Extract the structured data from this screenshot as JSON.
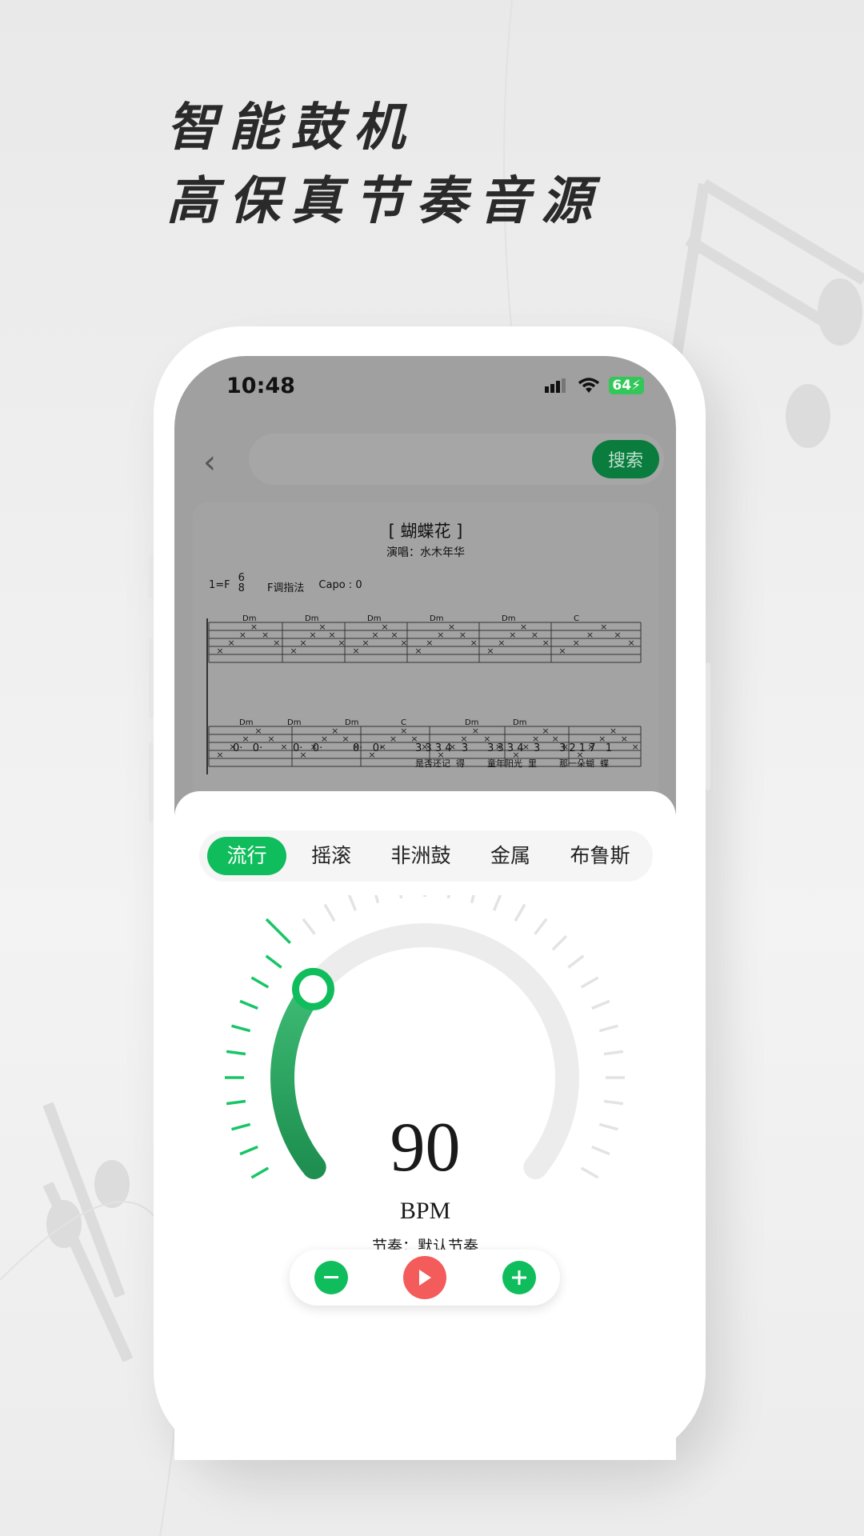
{
  "headline": {
    "line1": "智能鼓机",
    "line2": "高保真节奏音源"
  },
  "status_bar": {
    "time": "10:48",
    "battery": "64"
  },
  "search": {
    "value": "",
    "button": "搜索"
  },
  "score": {
    "title": "[ 蝴蝶花 ]",
    "singer": "演唱：水木年华",
    "key": "1=F",
    "time_sig_top": "6",
    "time_sig_bottom": "8",
    "fingering": "F调指法",
    "capo": "Capo : 0",
    "row1_chords": [
      "Dm",
      "Dm",
      "Dm",
      "Dm",
      "Dm",
      "C"
    ],
    "row1_notation": [
      "0·   0·",
      "0·   0·",
      "0·   0·",
      "3 3 3 4   3",
      "3 3 3 4   3",
      "3 2 1 7   1"
    ],
    "row1_lyrics": [
      "是否还记  得",
      "童年阳光  里",
      "那一朵蝴  蝶"
    ],
    "row2_chords": [
      "Dm",
      "Dm",
      "Dm",
      "C",
      "Dm",
      "Dm"
    ]
  },
  "tabs": [
    {
      "label": "流行",
      "active": true
    },
    {
      "label": "摇滚"
    },
    {
      "label": "非洲鼓"
    },
    {
      "label": "金属"
    },
    {
      "label": "布鲁斯"
    }
  ],
  "metronome": {
    "bpm": "90",
    "unit": "BPM",
    "rhythm": "节奏：默认节奏",
    "dial_progress": 0.3
  },
  "controls": {
    "minus": "minus-icon",
    "play": "play-icon",
    "plus": "plus-icon"
  },
  "colors": {
    "accent": "#10bd5c",
    "play": "#f45b5b",
    "dial_dark": "#1e8f50"
  }
}
